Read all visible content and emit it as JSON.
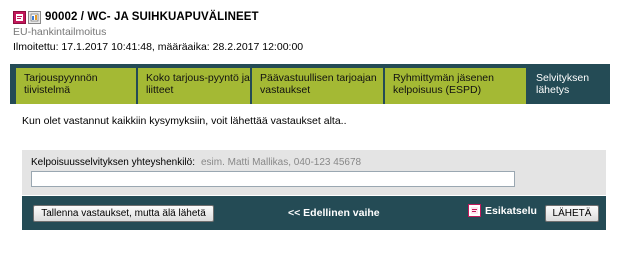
{
  "header": {
    "title": "90002 / WC- JA SUIHKUAPUVÄLINEET",
    "subtitle": "EU-hankintailmoitus",
    "announcement": "Ilmoitettu: 17.1.2017 10:41:48, määräaika: 28.2.2017 12:00:00",
    "icons": [
      "pdf-icon",
      "document-icon"
    ]
  },
  "tabs": [
    {
      "label": "Tarjouspyynnön tiivistelmä",
      "active": false
    },
    {
      "label": "Koko tarjous-pyyntö ja liitteet",
      "active": false
    },
    {
      "label": "Päävastuullisen tarjoajan vastaukset",
      "active": false
    },
    {
      "label": "Ryhmittymän jäsenen kelpoisuus (ESPD)",
      "active": false
    },
    {
      "label": "Selvityksen lähetys",
      "active": true
    }
  ],
  "main": {
    "instruction": "Kun olet vastannut kaikkiin kysymyksiin, voit lähettää vastaukset alta..",
    "contact": {
      "label": "Kelpoisuusselvityksen yhteyshenkilö:",
      "hint": "esim. Matti Mallikas, 040-123 45678",
      "value": ""
    }
  },
  "actions": {
    "save_label": "Tallenna vastaukset, mutta älä lähetä",
    "previous_label": "<< Edellinen vaihe",
    "preview_label": "Esikatselu",
    "send_label": "LÄHETÄ"
  },
  "colors": {
    "tab_green": "#a4b934",
    "dark_teal": "#244b55",
    "panel_gray": "#e4e4e4",
    "pdf_magenta": "#c2185b"
  }
}
